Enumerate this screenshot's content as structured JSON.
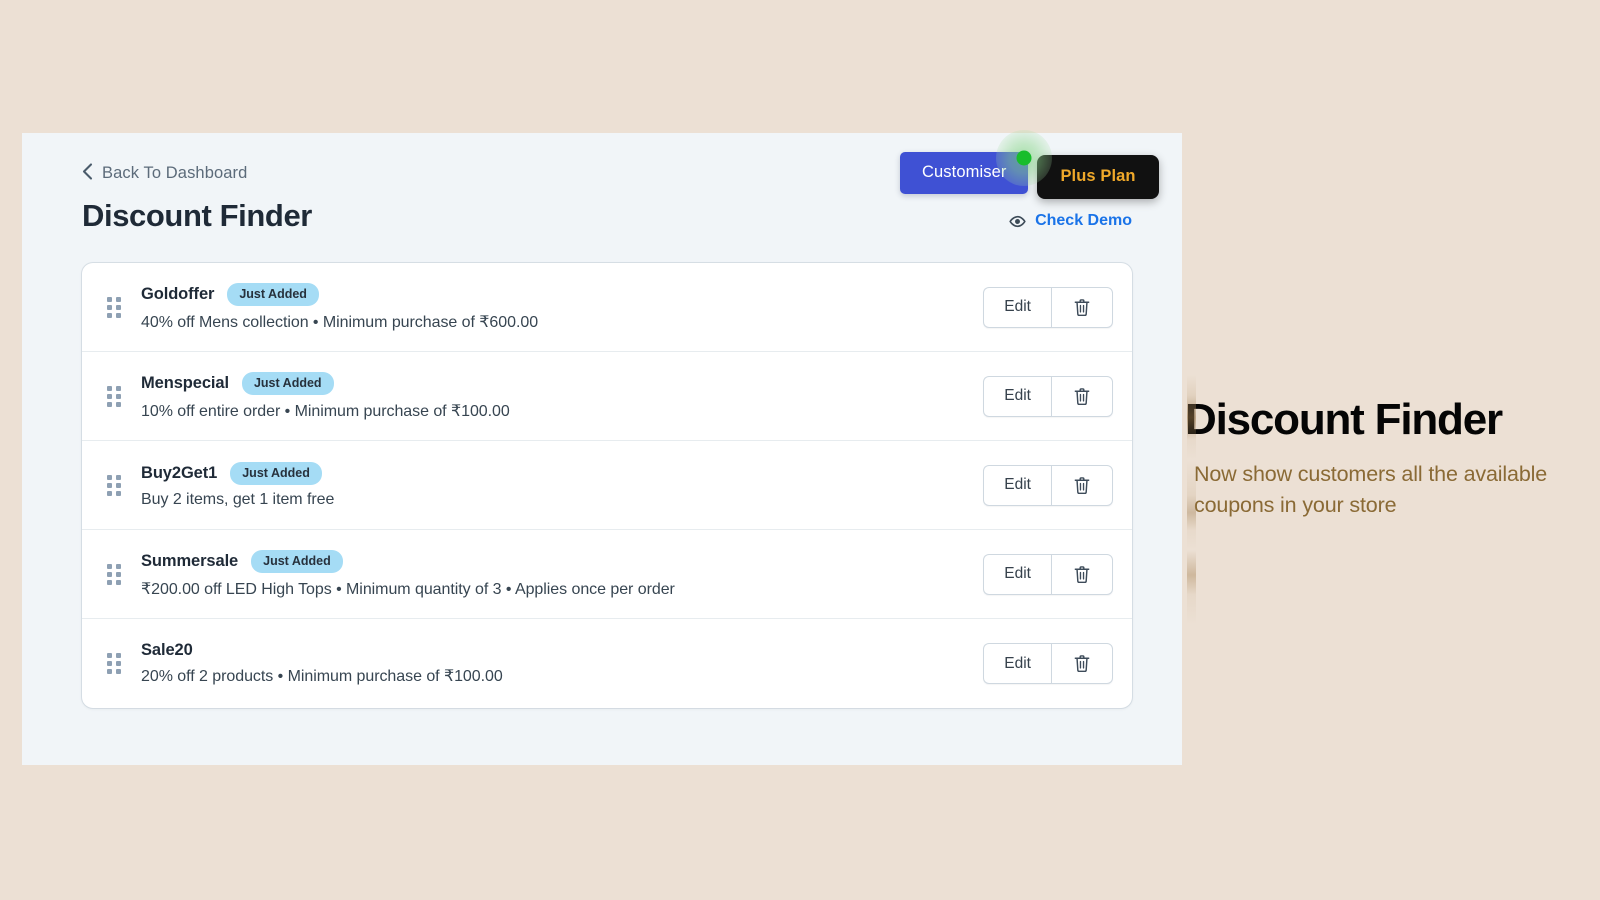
{
  "app": {
    "back_label": "Back To Dashboard",
    "page_title": "Discount Finder",
    "check_demo_label": "Check Demo"
  },
  "toolbar": {
    "customiser_label": "Customiser",
    "plus_plan_label": "Plus Plan"
  },
  "colors": {
    "outer_background": "#ece0d4",
    "panel_background": "#f1f5f8",
    "customiser_button": "#3f51d4",
    "plus_plan_button": "#111111",
    "plus_plan_text": "#f0a92a",
    "link_blue": "#1a73e8",
    "badge_blue": "#a5dcf5",
    "indicator_green": "#18bd2b",
    "promo_subtitle": "#8a6a35"
  },
  "discounts": [
    {
      "code": "Goldoffer",
      "badge": "Just Added",
      "description": "40% off Mens collection • Minimum purchase of ₹600.00",
      "edit_label": "Edit"
    },
    {
      "code": "Menspecial",
      "badge": "Just Added",
      "description": "10% off entire order • Minimum purchase of ₹100.00",
      "edit_label": "Edit"
    },
    {
      "code": "Buy2Get1",
      "badge": "Just Added",
      "description": "Buy 2 items, get 1 item free",
      "edit_label": "Edit"
    },
    {
      "code": "Summersale",
      "badge": "Just Added",
      "description": "₹200.00 off LED High Tops • Minimum quantity of 3 • Applies once per order",
      "edit_label": "Edit"
    },
    {
      "code": "Sale20",
      "badge": "",
      "description": "20% off 2 products • Minimum purchase of ₹100.00",
      "edit_label": "Edit"
    }
  ],
  "promo": {
    "title": "Discount Finder",
    "subtitle": "Now show customers all the available coupons in your store"
  },
  "icons": {
    "back_chevron": "‹",
    "eye": "eye-icon",
    "trash": "trash-icon",
    "drag": "drag-handle-icon"
  }
}
